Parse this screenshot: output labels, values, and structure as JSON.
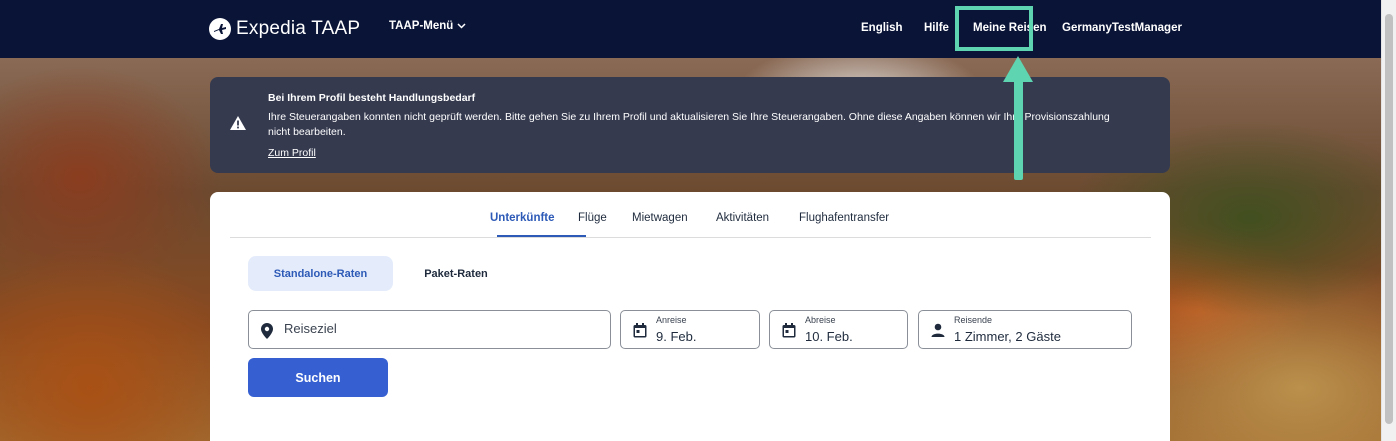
{
  "header": {
    "logo_text": "Expedia TAAP",
    "menu_label": "TAAP-Menü",
    "nav": {
      "english": "English",
      "help": "Hilfe",
      "my_trips": "Meine Reisen",
      "account": "GermanyTestManager"
    }
  },
  "alert": {
    "title": "Bei Ihrem Profil besteht Handlungsbedarf",
    "body": "Ihre Steuerangaben konnten nicht geprüft werden. Bitte gehen Sie zu Ihrem Profil und aktualisieren Sie Ihre Steuerangaben. Ohne diese Angaben können wir Ihre Provisionszahlung nicht bearbeiten.",
    "link": "Zum Profil"
  },
  "tabs": [
    "Unterkünfte",
    "Flüge",
    "Mietwagen",
    "Aktivitäten",
    "Flughafentransfer"
  ],
  "rates": {
    "standalone": "Standalone-Raten",
    "package": "Paket-Raten"
  },
  "fields": {
    "destination_placeholder": "Reiseziel",
    "checkin_label": "Anreise",
    "checkin_value": "9. Feb.",
    "checkout_label": "Abreise",
    "checkout_value": "10. Feb.",
    "travelers_label": "Reisende",
    "travelers_value": "1 Zimmer, 2 Gäste"
  },
  "search_label": "Suchen",
  "colors": {
    "header_bg": "#0a1437",
    "alert_bg": "#353a4f",
    "accent": "#2d5ab7",
    "button": "#3660d1",
    "highlight": "#5fd4b0"
  }
}
